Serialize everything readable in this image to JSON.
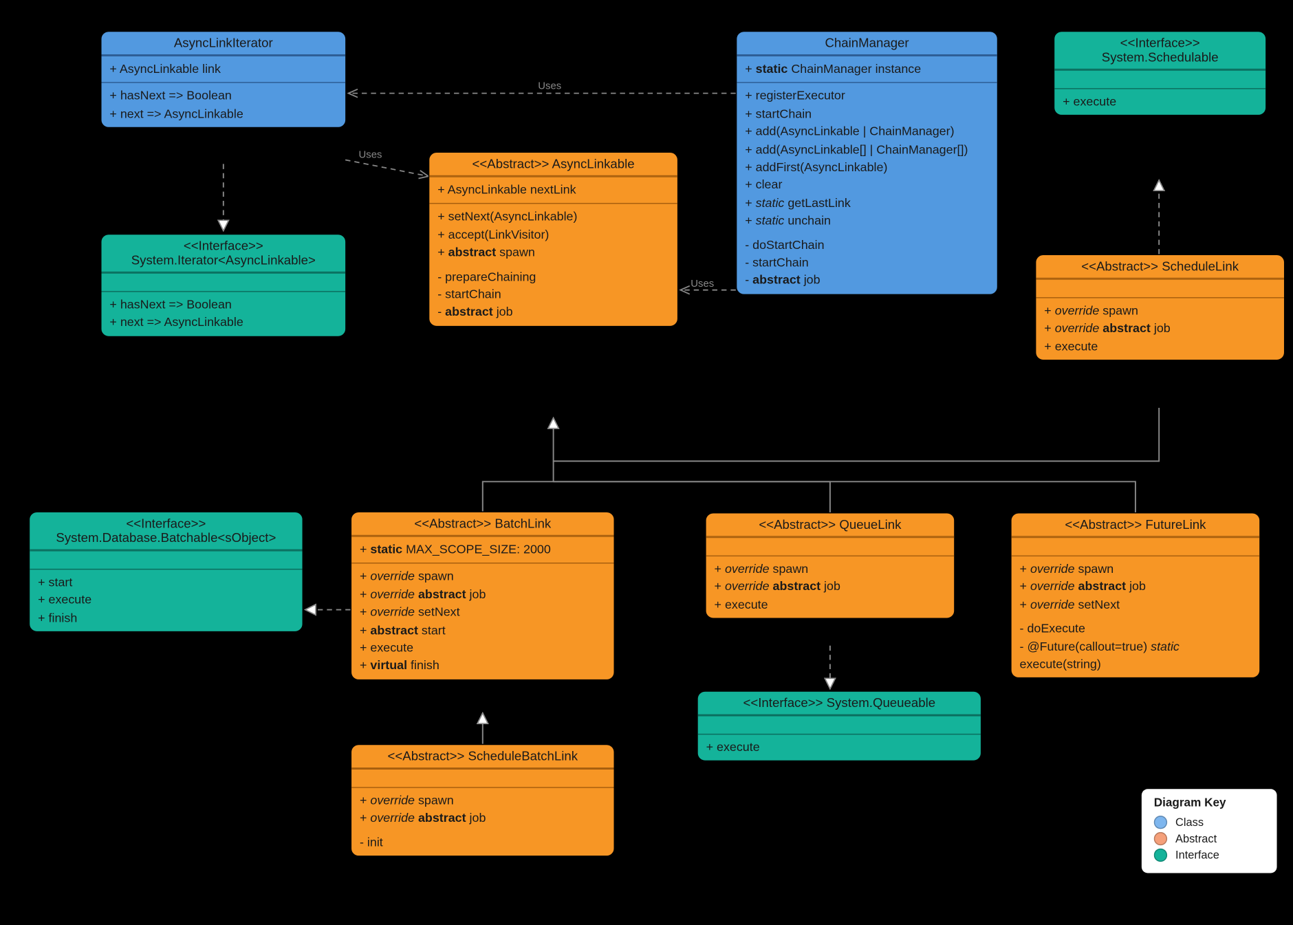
{
  "legend": {
    "title": "Diagram Key",
    "class": "Class",
    "abstract": "Abstract",
    "interface": "Interface"
  },
  "labels": {
    "uses1": "Uses",
    "uses2": "Uses",
    "uses3": "Uses"
  },
  "boxes": {
    "asyncLinkIterator": {
      "title": "AsyncLinkIterator",
      "attrs": [
        "+ AsyncLinkable link"
      ],
      "ops": [
        "+ hasNext => Boolean",
        "+ next => AsyncLinkable"
      ]
    },
    "systemIterator": {
      "stereo": "<<Interface>>",
      "title": "System.Iterator<AsyncLinkable>",
      "ops": [
        "+ hasNext => Boolean",
        "+ next => AsyncLinkable"
      ]
    },
    "asyncLinkable": {
      "stereo": "<<Abstract>>",
      "title": "AsyncLinkable",
      "attrs": [
        "+ AsyncLinkable nextLink"
      ],
      "opsPub": [
        "+ setNext(AsyncLinkable)",
        "+ accept(LinkVisitor)"
      ],
      "opsPubAbs": "+ <b>abstract</b> spawn",
      "opsPriv": [
        "- prepareChaining",
        "- startChain"
      ],
      "opsPrivAbs": "- <b>abstract</b> job"
    },
    "chainManager": {
      "title": "ChainManager",
      "attrsHtml": "+ <b>static</b> ChainManager instance",
      "opsPub": [
        "+ registerExecutor",
        "+ startChain",
        "+ add(AsyncLinkable | ChainManager)",
        "+ add(AsyncLinkable[] | ChainManager[])",
        "+ addFirst(AsyncLinkable)",
        "+ clear",
        "+ <i>static</i> getLastLink",
        "+ <i>static</i> unchain"
      ],
      "opsPriv": [
        "- doStartChain",
        "- startChain",
        "- <b>abstract</b> job"
      ]
    },
    "systemSchedulable": {
      "stereo": "<<Interface>>",
      "title": "System.Schedulable",
      "ops": [
        "+ execute"
      ]
    },
    "scheduleLink": {
      "stereo": "<<Abstract>>",
      "title": "ScheduleLink",
      "ops": [
        "+ <i>override</i> spawn",
        "+ <i>override</i> <b>abstract</b> job",
        "+ execute"
      ]
    },
    "batchable": {
      "stereo": "<<Interface>>",
      "title": "System.Database.Batchable<sObject>",
      "ops": [
        "+ start",
        "+ execute",
        "+ finish"
      ]
    },
    "batchLink": {
      "stereo": "<<Abstract>>",
      "title": "BatchLink",
      "attrs": "+ <b>static</b> MAX_SCOPE_SIZE: 2000",
      "ops": [
        "+ <i>override</i> spawn",
        "+ <i>override</i> <b>abstract</b> job",
        "+ <i>override</i> setNext",
        "+ <b>abstract</b> start",
        "+ execute",
        "+ <b>virtual</b> finish"
      ]
    },
    "scheduleBatchLink": {
      "stereo": "<<Abstract>>",
      "title": "ScheduleBatchLink",
      "ops": [
        "+ <i>override</i> spawn",
        "+ <i>override</i> <b>abstract</b> job"
      ],
      "priv": [
        "- init"
      ]
    },
    "queueLink": {
      "stereo": "<<Abstract>>",
      "title": "QueueLink",
      "ops": [
        "+ <i>override</i> spawn",
        "+ <i>override</i> <b>abstract</b> job",
        "+ execute"
      ]
    },
    "systemQueueable": {
      "stereo": "<<Interface>>",
      "title": "System.Queueable",
      "ops": [
        "+ execute"
      ]
    },
    "futureLink": {
      "stereo": "<<Abstract>>",
      "title": "FutureLink",
      "ops": [
        "+ <i>override</i> spawn",
        "+ <i>override</i> <b>abstract</b> job",
        "+ <i>override</i> setNext"
      ],
      "priv": [
        "- doExecute",
        "- @Future(callout=true) <i>static</i> execute(string)"
      ]
    }
  }
}
